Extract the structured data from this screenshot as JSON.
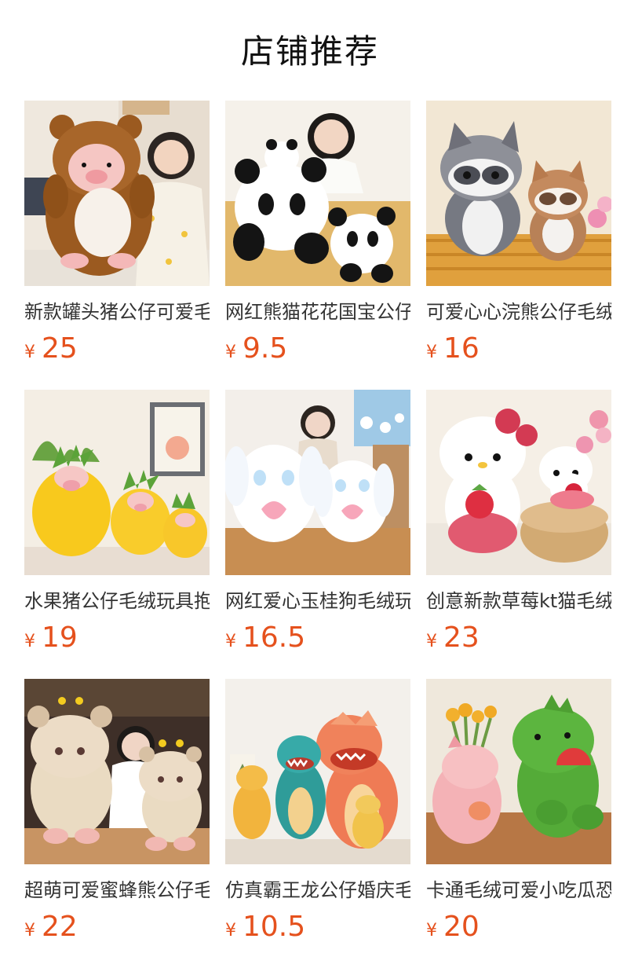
{
  "section": {
    "title": "店铺推荐"
  },
  "products": [
    {
      "name": "新款罐头猪公仔可爱毛绒玩具",
      "currency": "¥",
      "price": "25",
      "image_icon": "plush-pig-bear-photo-icon"
    },
    {
      "name": "网红熊猫花花国宝公仔毛绒玩具",
      "currency": "¥",
      "price": "9.5",
      "image_icon": "plush-panda-photo-icon"
    },
    {
      "name": "可爱心心浣熊公仔毛绒玩具",
      "currency": "¥",
      "price": "16",
      "image_icon": "plush-raccoon-photo-icon"
    },
    {
      "name": "水果猪公仔毛绒玩具抱枕",
      "currency": "¥",
      "price": "19",
      "image_icon": "plush-pineapple-pig-photo-icon"
    },
    {
      "name": "网红爱心玉桂狗毛绒玩具",
      "currency": "¥",
      "price": "16.5",
      "image_icon": "plush-cinnamoroll-photo-icon"
    },
    {
      "name": "创意新款草莓kt猫毛绒玩具",
      "currency": "¥",
      "price": "23",
      "image_icon": "plush-kitty-strawberry-photo-icon"
    },
    {
      "name": "超萌可爱蜜蜂熊公仔毛绒玩具",
      "currency": "¥",
      "price": "22",
      "image_icon": "plush-bee-bear-photo-icon"
    },
    {
      "name": "仿真霸王龙公仔婚庆毛绒玩具",
      "currency": "¥",
      "price": "10.5",
      "image_icon": "plush-dinosaur-photo-icon"
    },
    {
      "name": "卡通毛绒可爱小吃瓜恐龙公仔",
      "currency": "¥",
      "price": "20",
      "image_icon": "plush-green-dino-photo-icon"
    }
  ]
}
